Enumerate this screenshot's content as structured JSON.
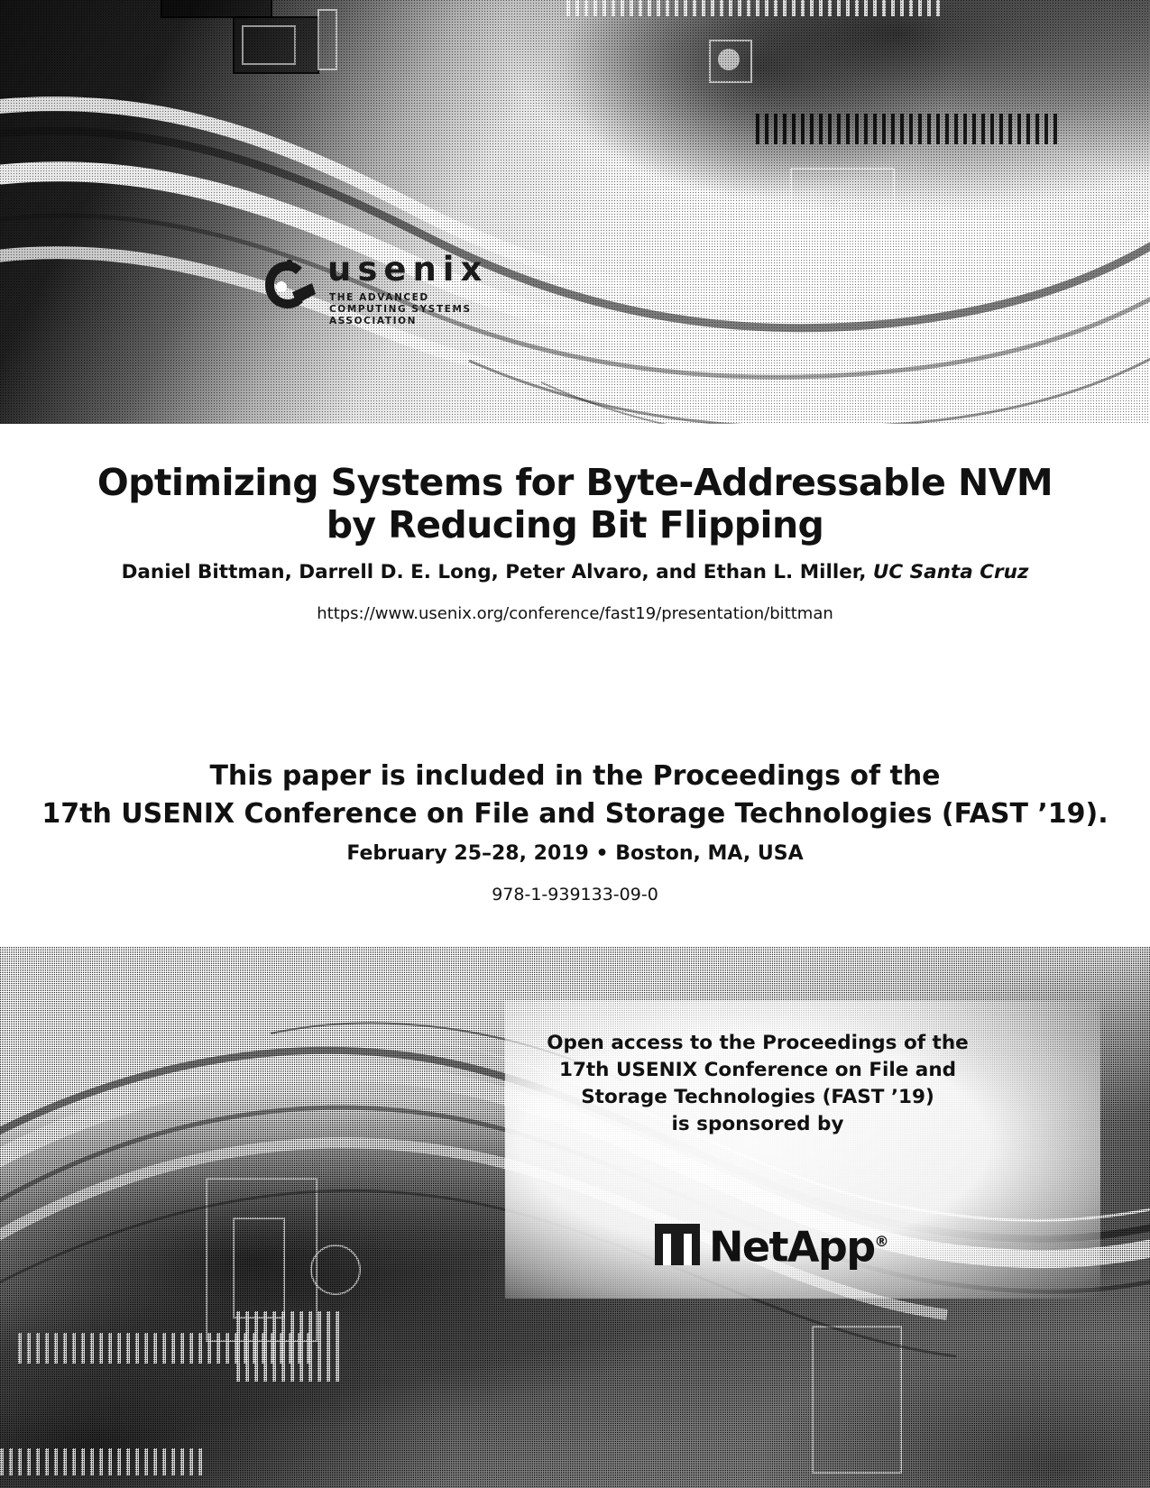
{
  "document": {
    "type": "conference-paper-cover",
    "publisher": "USENIX"
  },
  "top_banner": {
    "logo": {
      "wordmark": "usenix",
      "tagline_line_1": "THE ADVANCED",
      "tagline_line_2": "COMPUTING SYSTEMS",
      "tagline_line_3": "ASSOCIATION",
      "mark_icon": "usenix-gear-mark-icon"
    }
  },
  "paper": {
    "title_line_1": "Optimizing Systems for Byte-Addressable NVM",
    "title_line_2": "by Reducing Bit Flipping",
    "authors": "Daniel Bittman, Darrell D. E. Long, Peter Alvaro, and Ethan L. Miller, ",
    "affiliation": "UC Santa Cruz",
    "url": "https://www.usenix.org/conference/fast19/presentation/bittman"
  },
  "proceedings": {
    "line_1": "This paper is included in the Proceedings of the",
    "line_2": "17th USENIX Conference on File and Storage Technologies (FAST ’19).",
    "date_location": "February 25–28, 2019 • Boston, MA, USA",
    "isbn": "978-1-939133-09-0"
  },
  "sponsor": {
    "line_1": "Open access to the Proceedings of the",
    "line_2": "17th USENIX Conference on File and",
    "line_3": "Storage Technologies (FAST ’19)",
    "line_4": "is sponsored by",
    "logo_name": "NetApp",
    "logo_registered_mark": "®",
    "logo_icon": "netapp-n-mark-icon"
  },
  "colors": {
    "text": "#111111",
    "page_background": "#ffffff",
    "banner_tint": "#f2f2f2"
  }
}
